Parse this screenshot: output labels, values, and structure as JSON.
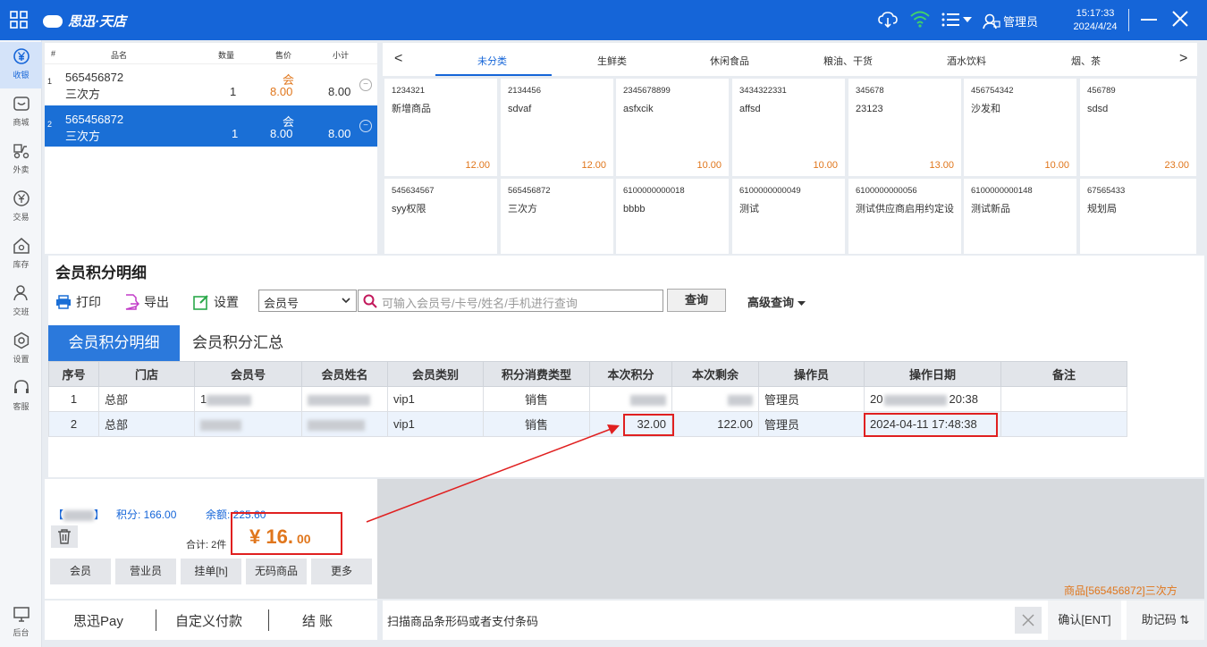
{
  "titlebar": {
    "brand": "思迅·天店",
    "user": "管理员",
    "time": "15:17:33",
    "date": "2024/4/24"
  },
  "sidebar": {
    "items": [
      {
        "label": "收银",
        "icon": "yen-circle-icon"
      },
      {
        "label": "商城",
        "icon": "store-icon"
      },
      {
        "label": "外卖",
        "icon": "scooter-icon"
      },
      {
        "label": "交易",
        "icon": "yen-circle-icon"
      },
      {
        "label": "库存",
        "icon": "home-icon"
      },
      {
        "label": "交班",
        "icon": "person-icon"
      },
      {
        "label": "设置",
        "icon": "gear-icon"
      },
      {
        "label": "客服",
        "icon": "headset-icon"
      },
      {
        "label": "后台",
        "icon": "monitor-icon"
      }
    ]
  },
  "cart": {
    "headers": {
      "no": "#",
      "name": "品名",
      "qty": "数量",
      "price": "售价",
      "subtotal": "小计"
    },
    "rows": [
      {
        "no": "1",
        "code": "565456872",
        "name": "三次方",
        "qty": "1",
        "badge": "会",
        "price": "8.00",
        "subtotal": "8.00"
      },
      {
        "no": "2",
        "code": "565456872",
        "name": "三次方",
        "qty": "1",
        "badge": "会",
        "price": "8.00",
        "subtotal": "8.00"
      }
    ]
  },
  "categories": {
    "prev": "<",
    "next": ">",
    "items": [
      "未分类",
      "生鲜类",
      "休闲食品",
      "粮油、干货",
      "酒水饮料",
      "烟、茶"
    ],
    "active": "未分类"
  },
  "products": [
    {
      "code": "1234321",
      "name": "新增商品",
      "price": "12.00"
    },
    {
      "code": "2134456",
      "name": "sdvaf",
      "price": "12.00"
    },
    {
      "code": "2345678899",
      "name": "asfxcik",
      "price": "10.00"
    },
    {
      "code": "3434322331",
      "name": "affsd",
      "price": "10.00"
    },
    {
      "code": "345678",
      "name": "23123",
      "price": "13.00"
    },
    {
      "code": "456754342",
      "name": "沙发和",
      "price": "10.00"
    },
    {
      "code": "456789",
      "name": "sdsd",
      "price": "23.00"
    },
    {
      "code": "545634567",
      "name": "syy权限",
      "price": ""
    },
    {
      "code": "565456872",
      "name": "三次方",
      "price": ""
    },
    {
      "code": "6100000000018",
      "name": "bbbb",
      "price": ""
    },
    {
      "code": "6100000000049",
      "name": "测试",
      "price": ""
    },
    {
      "code": "6100000000056",
      "name": "测试供应商启用约定设",
      "price": ""
    },
    {
      "code": "6100000000148",
      "name": "测试新品",
      "price": ""
    },
    {
      "code": "67565433",
      "name": "规划局",
      "price": ""
    }
  ],
  "dialog": {
    "title": "会员积分明细",
    "toolbar": {
      "print": "打印",
      "export": "导出",
      "settings": "设置"
    },
    "search_field": "会员号",
    "search_placeholder": "可输入会员号/卡号/姓名/手机进行查询",
    "query_button": "查询",
    "advanced_query": "高级查询",
    "tabs": [
      "会员积分明细",
      "会员积分汇总"
    ],
    "columns": [
      "序号",
      "门店",
      "会员号",
      "会员姓名",
      "会员类别",
      "积分消费类型",
      "本次积分",
      "本次剩余",
      "操作员",
      "操作日期",
      "备注"
    ],
    "rows": [
      {
        "no": "1",
        "store": "总部",
        "member_no": "1",
        "member_name": "",
        "type": "vip1",
        "consume": "销售",
        "points": "",
        "remain": "",
        "operator": "管理员",
        "date_start": "20",
        "date_end": "20:38",
        "remark": ""
      },
      {
        "no": "2",
        "store": "总部",
        "member_no": "",
        "member_name": "",
        "type": "vip1",
        "consume": "销售",
        "points": "32.00",
        "remain": "122.00",
        "operator": "管理员",
        "date": "2024-04-11 17:48:38",
        "remark": ""
      }
    ]
  },
  "checkout": {
    "points_label": "积分: 166.00",
    "balance_label": "余额: 225.60",
    "total_label": "合计: 2件",
    "amount": "¥ 16.",
    "amount_cents": "00",
    "actions": [
      "会员",
      "营业员",
      "挂单[h]",
      "无码商品",
      "更多"
    ]
  },
  "bottom": {
    "pay_buttons": [
      "思迅Pay",
      "自定义付款",
      "结 账"
    ],
    "scan_placeholder": "扫描商品条形码或者支付条码",
    "confirm": "确认[ENT]",
    "helper": "助记码 ⇅",
    "current_item": "商品[565456872]三次方"
  },
  "colors": {
    "primary": "#1565d8",
    "price_orange": "#e0761c",
    "highlight_red": "#e02020"
  }
}
